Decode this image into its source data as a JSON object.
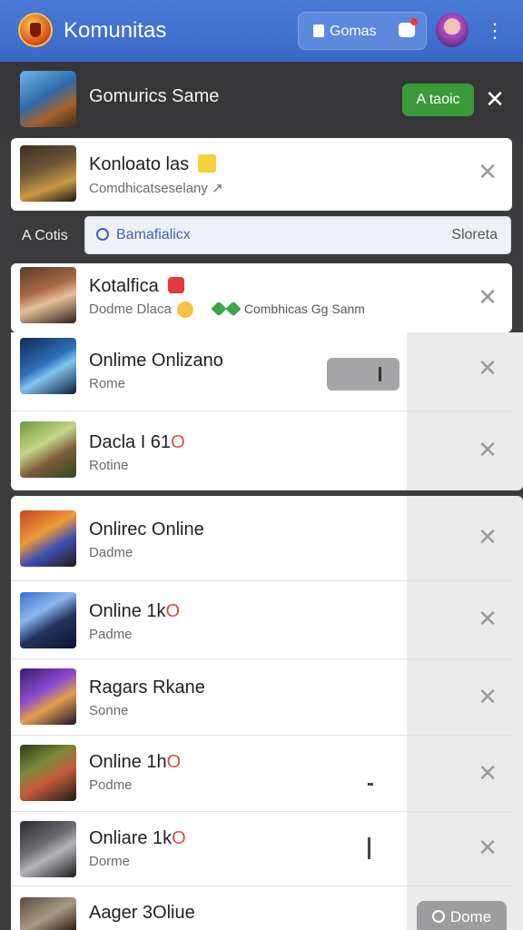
{
  "appbar": {
    "title": "Komunitas",
    "chip_label": "Gomas",
    "icons": [
      "app-logo-icon",
      "bag-icon",
      "chat-icon",
      "avatar",
      "more-vert-icon"
    ],
    "accent": "#3a68c6"
  },
  "header": {
    "title": "Gomurics Same",
    "add_label": "A taoic",
    "close": "✕"
  },
  "pinned_card": {
    "title": "Konloato las",
    "subtitle": "Comdhicatseselany",
    "subtitle_icon": "↗"
  },
  "search": {
    "left_label": "A Cotis",
    "text": "Bamafialicx",
    "right_label": "Sloreta"
  },
  "featured_card": {
    "title": "Kotalfica",
    "subtitle": "Dodme Dlaca",
    "extra": "Combhicas Gg Sanm"
  },
  "items": [
    {
      "title": "Onlime Onlizano",
      "subtitle": "Rome"
    },
    {
      "title": "Dacla I 61",
      "title_red": "O",
      "subtitle": "Rotine"
    },
    {
      "title": "Onlirec Online",
      "subtitle": "Dadme"
    },
    {
      "title": "Online 1k",
      "title_red": "O",
      "subtitle": "Padme"
    },
    {
      "title": "Ragars Rkane",
      "subtitle": "Sonne"
    },
    {
      "title": "Online 1h",
      "title_red": "O",
      "subtitle": "Podme"
    },
    {
      "title": "Onliare 1k",
      "title_red": "O",
      "subtitle": "Dorme"
    },
    {
      "title": "Aager 3Oliue",
      "subtitle": ""
    }
  ],
  "done_button": {
    "label": "Dome"
  },
  "close_glyph": "✕",
  "colors": {
    "add_button": "#3b9a3a",
    "appbar": "#4a7bd8",
    "badge_red": "#e03a3a",
    "badge_yellow": "#f2d13a"
  }
}
